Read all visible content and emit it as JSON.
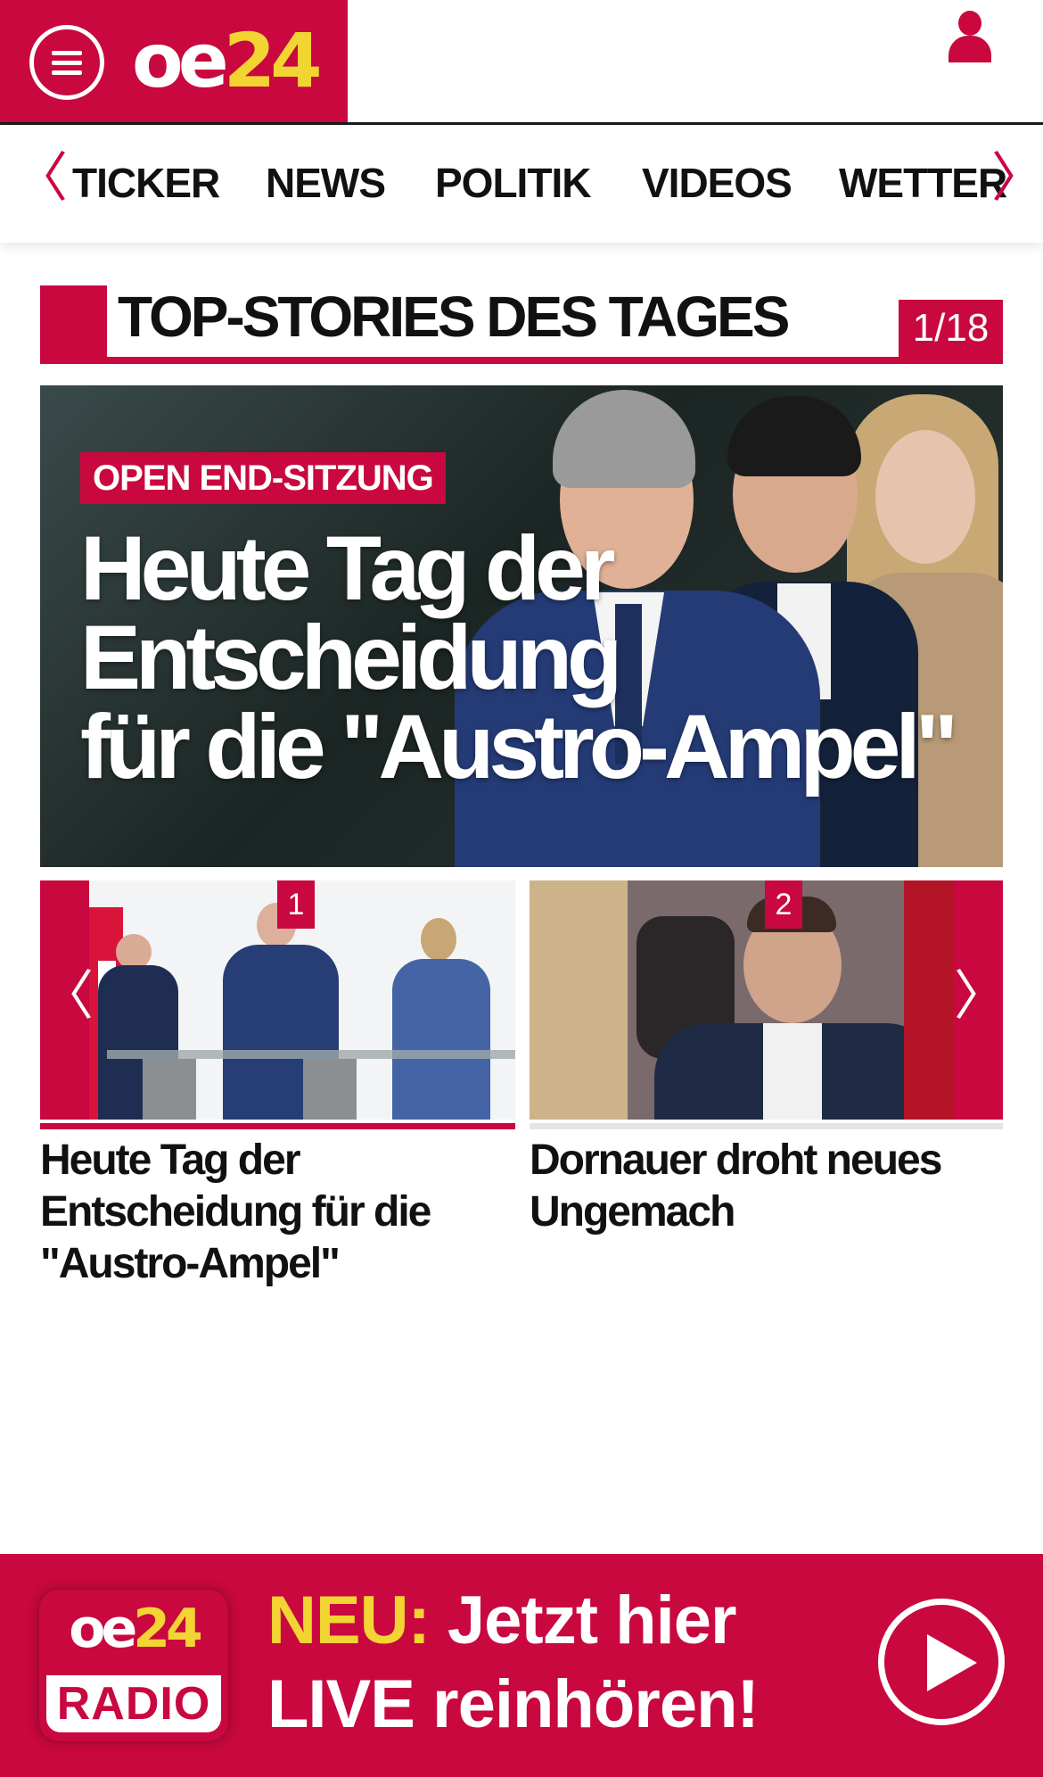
{
  "header": {
    "logo_oe": "oe",
    "logo_num": "24",
    "brand_color": "#c8083f",
    "accent_color": "#f2d533"
  },
  "nav": {
    "prev_arrow": "〈",
    "next_arrow": "〉",
    "items": [
      "TICKER",
      "NEWS",
      "POLITIK",
      "VIDEOS",
      "WETTER"
    ]
  },
  "section": {
    "title": "TOP-STORIES DES TAGES",
    "counter": "1/18"
  },
  "hero": {
    "kicker": "OPEN END-SITZUNG",
    "headline_lines": [
      "Heute Tag der",
      "Entscheidung",
      "für die \"Austro-Ampel\""
    ]
  },
  "carousel": {
    "prev_arrow": "〈",
    "next_arrow": "〉",
    "cards": [
      {
        "badge": "1",
        "title": "Heute Tag der Entscheidung für die \"Austro-Ampel\""
      },
      {
        "badge": "2",
        "title": "Dornauer droht neues Ungemach"
      }
    ]
  },
  "radio": {
    "logo_oe": "oe",
    "logo_num": "24",
    "logo_radio": "RADIO",
    "highlight": "NEU:",
    "line1_rest": " Jetzt hier",
    "line2": "LIVE reinhören!"
  }
}
